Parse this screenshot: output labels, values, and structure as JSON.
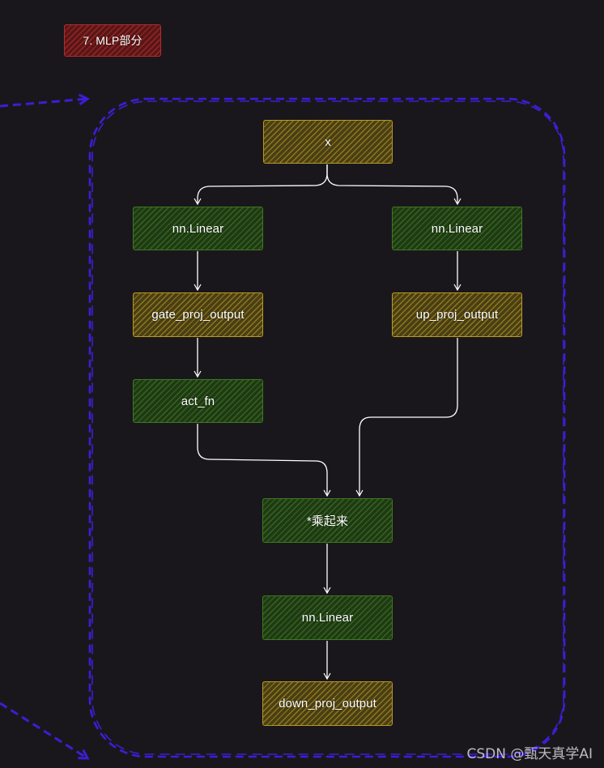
{
  "diagram": {
    "title": "7. MLP部分",
    "nodes": {
      "x": "x",
      "linear_gate": "nn.Linear",
      "linear_up": "nn.Linear",
      "gate_proj_output": "gate_proj_output",
      "up_proj_output": "up_proj_output",
      "act_fn": "act_fn",
      "multiply": "*乘起来",
      "linear_down": "nn.Linear",
      "down_proj_output": "down_proj_output"
    }
  },
  "watermark": "CSDN @甄天真学AI",
  "colors": {
    "background": "#1a171c",
    "frame": "#3b1fd6",
    "data_node": "#b89a22",
    "op_node": "#3c7a20",
    "title_node": "#b32a2a",
    "arrow": "#ffffff"
  }
}
